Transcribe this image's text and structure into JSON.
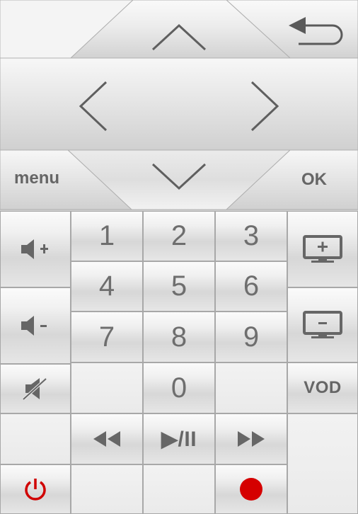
{
  "remote": {
    "menu_label": "menu",
    "ok_label": "OK",
    "vod_label": "VOD",
    "keypad": [
      "1",
      "2",
      "3",
      "4",
      "5",
      "6",
      "7",
      "8",
      "9",
      "0"
    ],
    "play_pause_label": "▶/II",
    "icons": {
      "back": "back-arrow-icon",
      "up": "chevron-up-icon",
      "down": "chevron-down-icon",
      "left": "chevron-left-icon",
      "right": "chevron-right-icon",
      "volume_up": "volume-up-icon",
      "volume_down": "volume-down-icon",
      "mute": "mute-icon",
      "channel_up": "channel-up-icon",
      "channel_down": "channel-down-icon",
      "rewind": "rewind-icon",
      "fast_forward": "fast-forward-icon",
      "power": "power-icon",
      "record": "record-icon"
    },
    "colors": {
      "power": "#d00000",
      "record": "#d50000",
      "icon_gray": "#666666"
    }
  }
}
